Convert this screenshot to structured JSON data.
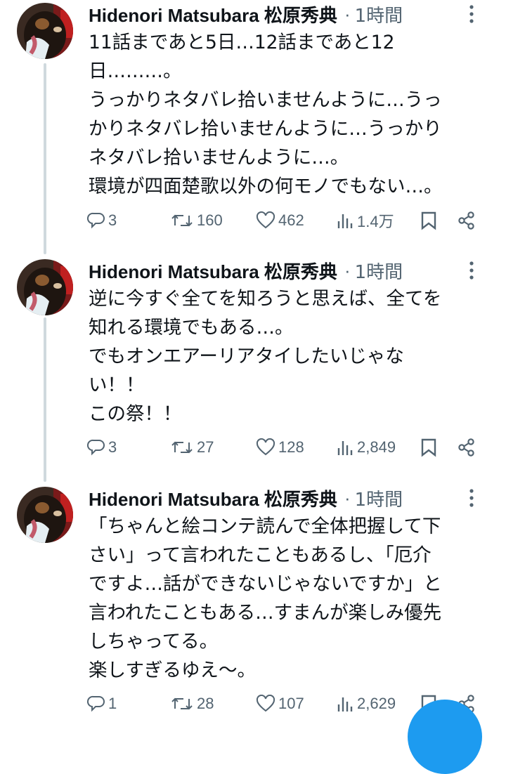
{
  "author": {
    "name": "Hidenori Matsubara 松原秀典"
  },
  "tweets": [
    {
      "time": "1時間",
      "lines": [
        "11話まであと5日…12話まであと12",
        "日………。",
        "うっかりネタバレ拾いませんように…うっ",
        "かりネタバレ拾いませんように…うっかり",
        "ネタバレ拾いませんように…。",
        "環境が四面楚歌以外の何モノでもない…。"
      ],
      "replies": "3",
      "retweets": "160",
      "likes": "462",
      "views": "1.4万"
    },
    {
      "time": "1時間",
      "lines": [
        "逆に今すぐ全てを知ろうと思えば、全てを",
        "知れる環境でもある…。",
        "でもオンエアーリアタイしたいじゃな",
        "い！！",
        "この祭！！"
      ],
      "replies": "3",
      "retweets": "27",
      "likes": "128",
      "views": "2,849"
    },
    {
      "time": "1時間",
      "lines": [
        "「ちゃんと絵コンテ読んで全体把握して下",
        "さい」って言われたこともあるし、「厄介",
        "ですよ…話ができないじゃないですか」と",
        "言われたこともある…すまんが楽しみ優先",
        "しちゃってる。",
        "楽しすぎるゆえ〜。"
      ],
      "replies": "1",
      "retweets": "28",
      "likes": "107",
      "views": "2,629"
    }
  ],
  "icons": {
    "reply": "reply-icon",
    "retweet": "retweet-icon",
    "like": "heart-icon",
    "views": "views-icon",
    "bookmark": "bookmark-icon",
    "share": "share-icon",
    "more": "more-icon",
    "compose": "compose-fab"
  },
  "colors": {
    "text": "#0f1419",
    "muted": "#536471",
    "thread_line": "#cfd9de",
    "accent": "#1d9bf0"
  }
}
